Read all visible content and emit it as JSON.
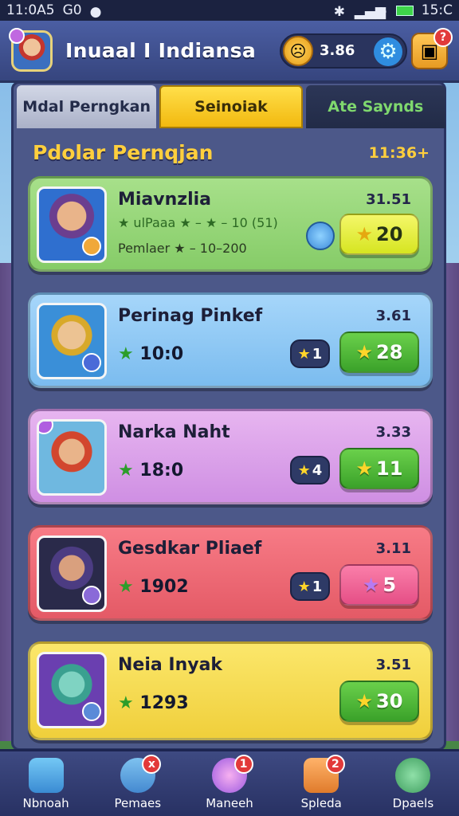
{
  "status_bar": {
    "time_left": "11:0A5",
    "left_icons_text": "G0",
    "time_right": "15:C"
  },
  "header": {
    "title": "Inuaal I Indiansa",
    "coins": "3.86",
    "mail_badge": "?"
  },
  "tabs": [
    {
      "label": "Mdal Perngkan"
    },
    {
      "label": "Seinoiak"
    },
    {
      "label": "Ate Saynds"
    }
  ],
  "section": {
    "title": "Pdolar Pernqjan",
    "time": "11:36+"
  },
  "cards": [
    {
      "name": "Miavnzlia",
      "number": "31.51",
      "line1": "★ ulPaaa ★ – ★ – 10 (51)",
      "line2": "Pemlaer ★ – 10–200",
      "button_value": "20"
    },
    {
      "name": "Perinag Pinkef",
      "number": "3.61",
      "score": "10:0",
      "small_value": "1",
      "button_value": "28"
    },
    {
      "name": "Narka Naht",
      "number": "3.33",
      "score": "18:0",
      "small_value": "4",
      "button_value": "11"
    },
    {
      "name": "Gesdkar Pliaef",
      "number": "3.11",
      "score": "1902",
      "small_value": "1",
      "button_value": "5"
    },
    {
      "name": "Neia Inyak",
      "number": "3.51",
      "score": "1293",
      "button_value": "30"
    }
  ],
  "nav": [
    {
      "label": "Nbnoah",
      "badge": ""
    },
    {
      "label": "Pemaes",
      "badge": "x"
    },
    {
      "label": "Maneeh",
      "badge": "1"
    },
    {
      "label": "Spleda",
      "badge": "2"
    },
    {
      "label": "Dpaels",
      "badge": ""
    }
  ]
}
